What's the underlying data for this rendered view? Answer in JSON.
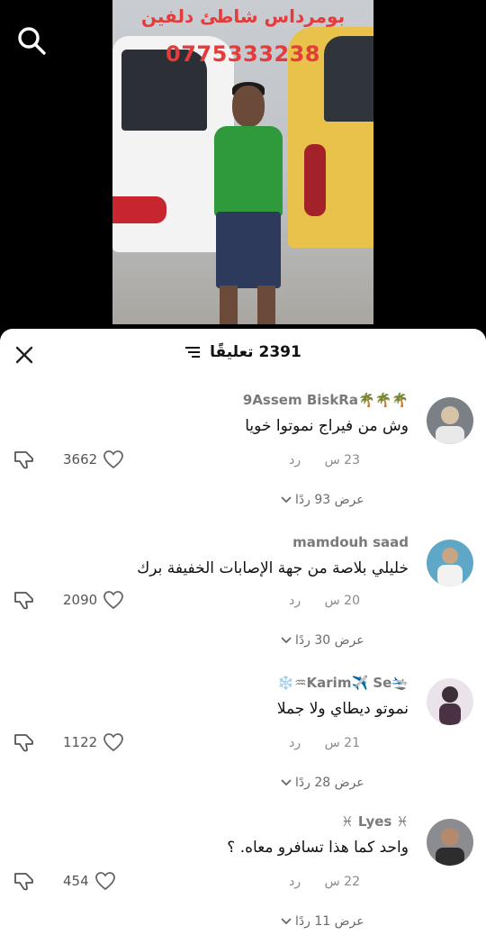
{
  "video": {
    "overlay_line1": "بومرداس شاطئ دلفين",
    "overlay_phone": "0775333238"
  },
  "sheet": {
    "count_label": "2391 تعليقًا"
  },
  "comments": [
    {
      "author": "9Assem BiskRa🌴🌴🌴",
      "text": "وش من فيراج نموتوا خويا",
      "time": "23 س",
      "reply_label": "رد",
      "likes": "3662",
      "replies_label": "عرض 93 ردًا"
    },
    {
      "author": "mamdouh saad",
      "text": "خليلي بلاصة من جهة الإصابات الخفيفة برك",
      "time": "20 س",
      "reply_label": "رد",
      "likes": "2090",
      "replies_label": "عرض 30 ردًا"
    },
    {
      "author": "❄️♒Karim✈️ Se🛬",
      "text": "نموتو ديطاي ولا جملا",
      "time": "21 س",
      "reply_label": "رد",
      "likes": "1122",
      "replies_label": "عرض 28 ردًا"
    },
    {
      "author": "♓ Lyes ♓",
      "text": "واحد كما هذا تسافرو معاه. ؟",
      "time": "22 س",
      "reply_label": "رد",
      "likes": "454",
      "replies_label": "عرض 11 ردًا"
    }
  ]
}
